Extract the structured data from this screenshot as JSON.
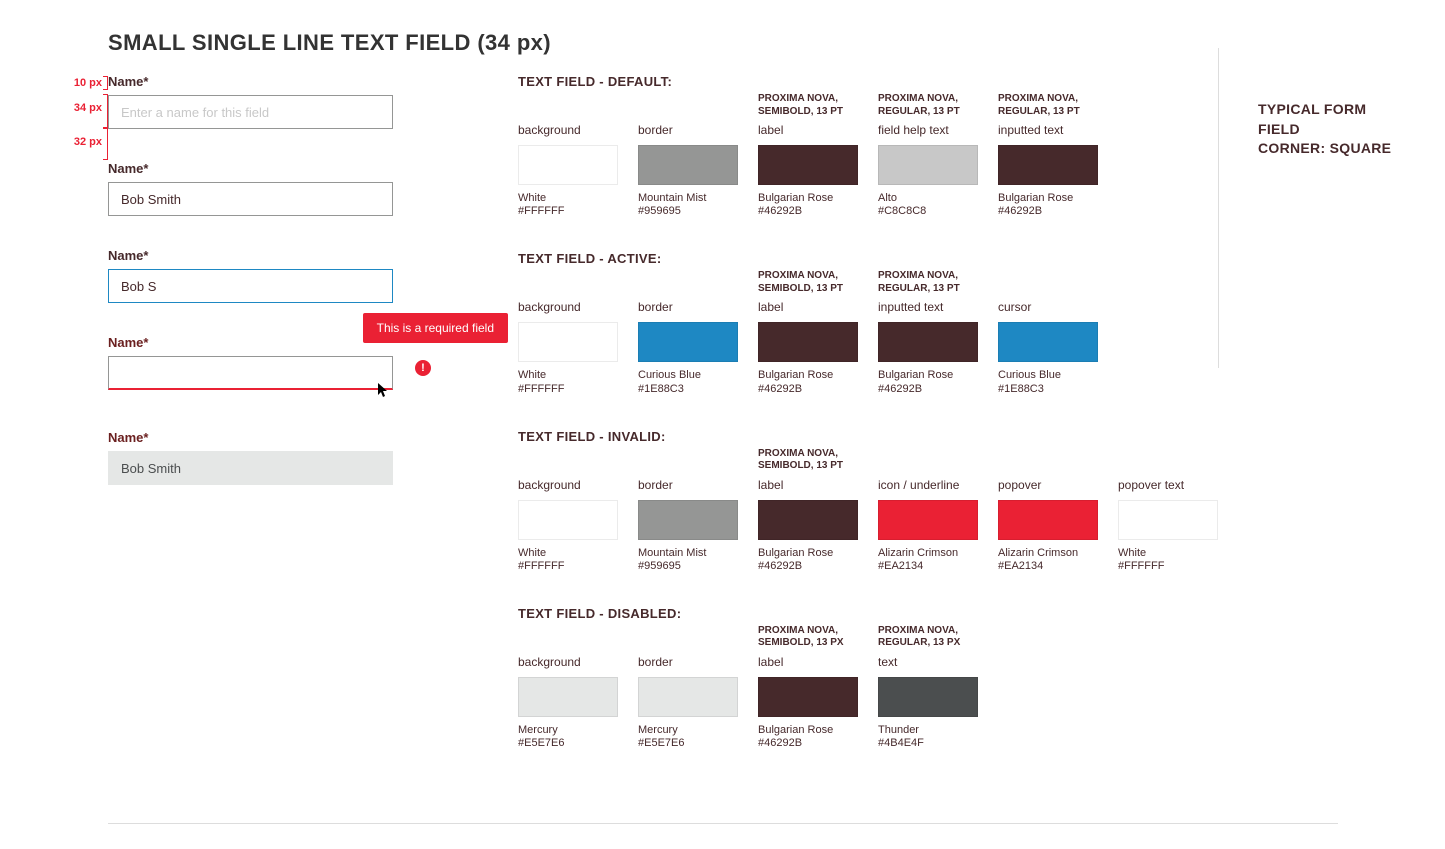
{
  "page_title": "SMALL SINGLE LINE TEXT FIELD (34 px)",
  "measurements": {
    "label_h": "10 px",
    "field_h": "34 px",
    "gap_h": "32 px"
  },
  "examples": {
    "default": {
      "label": "Name*",
      "placeholder": "Enter a name for this field"
    },
    "filled": {
      "label": "Name*",
      "value": "Bob Smith"
    },
    "active": {
      "label": "Name*",
      "value": "Bob S"
    },
    "invalid": {
      "label": "Name*",
      "error": "This is a required field"
    },
    "disabled": {
      "label": "Name*",
      "value": "Bob Smith"
    }
  },
  "note": {
    "line1": "TYPICAL FORM FIELD",
    "line2": "CORNER:  SQUARE"
  },
  "specs": {
    "default": {
      "title": "TEXT FIELD - DEFAULT:",
      "cols": [
        {
          "font": "",
          "head": "background",
          "hex": "#FFFFFF",
          "name": "White"
        },
        {
          "font": "",
          "head": "border",
          "hex": "#959695",
          "name": "Mountain Mist"
        },
        {
          "font": "PROXIMA NOVA, SEMIBOLD, 13 PT",
          "head": "label",
          "hex": "#46292B",
          "name": "Bulgarian Rose"
        },
        {
          "font": "PROXIMA NOVA, REGULAR, 13 PT",
          "head": "field help text",
          "hex": "#C8C8C8",
          "name": "Alto"
        },
        {
          "font": "PROXIMA NOVA, REGULAR, 13 PT",
          "head": "inputted text",
          "hex": "#46292B",
          "name": "Bulgarian Rose"
        }
      ]
    },
    "active": {
      "title": "TEXT FIELD - ACTIVE:",
      "cols": [
        {
          "font": "",
          "head": "background",
          "hex": "#FFFFFF",
          "name": "White"
        },
        {
          "font": "",
          "head": "border",
          "hex": "#1E88C3",
          "name": "Curious Blue"
        },
        {
          "font": "PROXIMA NOVA, SEMIBOLD, 13 PT",
          "head": "label",
          "hex": "#46292B",
          "name": "Bulgarian Rose"
        },
        {
          "font": "PROXIMA NOVA, REGULAR, 13 PT",
          "head": "inputted text",
          "hex": "#46292B",
          "name": "Bulgarian Rose"
        },
        {
          "font": "",
          "head": "cursor",
          "hex": "#1E88C3",
          "name": "Curious Blue"
        }
      ]
    },
    "invalid": {
      "title": "TEXT FIELD - INVALID:",
      "cols": [
        {
          "font": "",
          "head": "background",
          "hex": "#FFFFFF",
          "name": "White"
        },
        {
          "font": "",
          "head": "border",
          "hex": "#959695",
          "name": "Mountain Mist"
        },
        {
          "font": "PROXIMA NOVA, SEMIBOLD, 13 PT",
          "head": "label",
          "hex": "#46292B",
          "name": "Bulgarian Rose"
        },
        {
          "font": "",
          "head": "icon / underline",
          "hex": "#EA2134",
          "name": "Alizarin Crimson"
        },
        {
          "font": "",
          "head": "popover",
          "hex": "#EA2134",
          "name": "Alizarin Crimson"
        },
        {
          "font": "",
          "head": "popover text",
          "hex": "#FFFFFF",
          "name": "White"
        }
      ]
    },
    "disabled": {
      "title": "TEXT FIELD - DISABLED:",
      "cols": [
        {
          "font": "",
          "head": "background",
          "hex": "#E5E7E6",
          "name": "Mercury"
        },
        {
          "font": "",
          "head": "border",
          "hex": "#E5E7E6",
          "name": "Mercury"
        },
        {
          "font": "PROXIMA NOVA, SEMIBOLD, 13 PX",
          "head": "label",
          "hex": "#46292B",
          "name": "Bulgarian Rose"
        },
        {
          "font": "PROXIMA NOVA, REGULAR, 13 PX",
          "head": "text",
          "hex": "#4B4E4F",
          "name": "Thunder"
        }
      ]
    }
  }
}
